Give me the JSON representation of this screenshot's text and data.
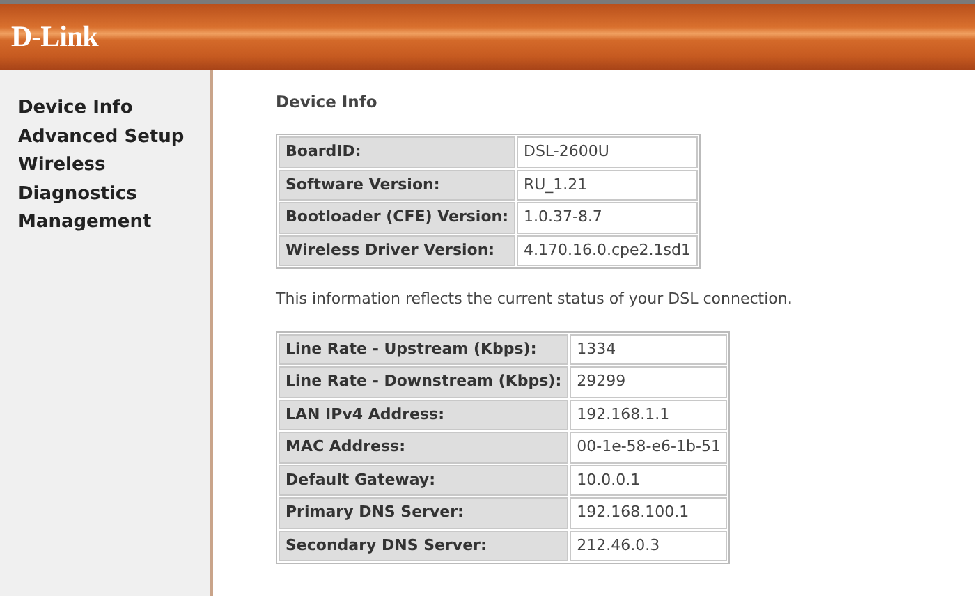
{
  "header": {
    "logo": "D-Link"
  },
  "sidebar": {
    "items": [
      {
        "label": "Device Info"
      },
      {
        "label": "Advanced Setup"
      },
      {
        "label": "Wireless"
      },
      {
        "label": "Diagnostics"
      },
      {
        "label": "Management"
      }
    ]
  },
  "content": {
    "title": "Device Info",
    "device_table": [
      {
        "label": "BoardID:",
        "value": "DSL-2600U"
      },
      {
        "label": "Software Version:",
        "value": "RU_1.21"
      },
      {
        "label": "Bootloader (CFE) Version:",
        "value": "1.0.37-8.7"
      },
      {
        "label": "Wireless Driver Version:",
        "value": "4.170.16.0.cpe2.1sd1"
      }
    ],
    "note": "This information reflects the current status of your DSL connection.",
    "status_table": [
      {
        "label": "Line Rate - Upstream (Kbps):",
        "value": "1334"
      },
      {
        "label": "Line Rate - Downstream (Kbps):",
        "value": "29299"
      },
      {
        "label": "LAN IPv4 Address:",
        "value": "192.168.1.1"
      },
      {
        "label": "MAC Address:",
        "value": "00-1e-58-e6-1b-51"
      },
      {
        "label": "Default Gateway:",
        "value": "10.0.0.1"
      },
      {
        "label": "Primary DNS Server:",
        "value": "192.168.100.1"
      },
      {
        "label": "Secondary DNS Server:",
        "value": "212.46.0.3"
      }
    ]
  }
}
